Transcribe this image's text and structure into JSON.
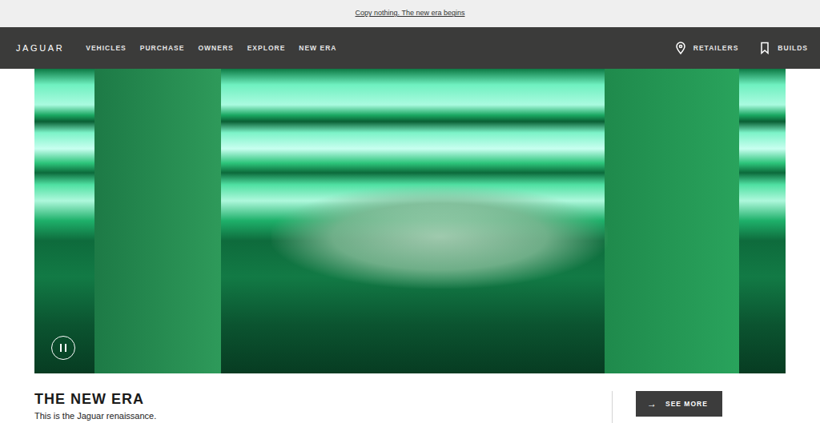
{
  "announcement": {
    "text": "Copy nothing. The new era begins"
  },
  "navbar": {
    "logo": "JAGUAR",
    "items": [
      {
        "label": "VEHICLES"
      },
      {
        "label": "PURCHASE"
      },
      {
        "label": "OWNERS"
      },
      {
        "label": "EXPLORE"
      },
      {
        "label": "NEW ERA"
      }
    ],
    "actions": [
      {
        "label": "RETAILERS",
        "kind": "pin"
      },
      {
        "label": "BUILDS",
        "kind": "bookmark"
      }
    ]
  },
  "hero": {
    "playing": true
  },
  "section": {
    "title": "THE NEW ERA",
    "text": "This is the Jaguar renaissance.",
    "button": {
      "icon": "→",
      "label": "SEE MORE"
    }
  }
}
